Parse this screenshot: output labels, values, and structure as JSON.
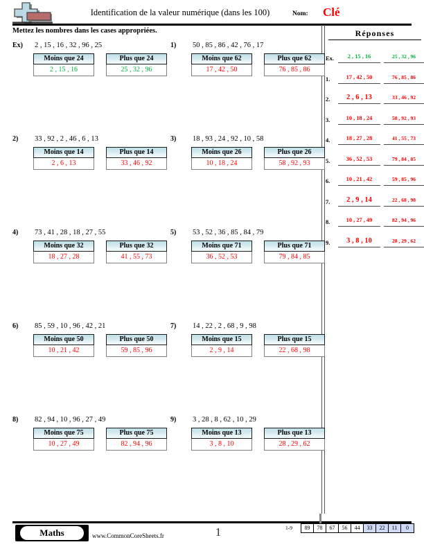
{
  "header": {
    "title": "Identification de la valeur numérique (dans les 100)",
    "name_label": "Nom:",
    "name_value": "Clé",
    "logo_icon": "plus-block-logo"
  },
  "instruction": "Mettez les nombres dans les cases appropriées.",
  "answers_panel": {
    "title": "Réponses",
    "rows": [
      {
        "num": "Ex.",
        "left": "2 , 15 , 16",
        "right": "25 , 32 , 96",
        "example": true,
        "left_size": "sz-md",
        "right_size": "sz-sm"
      },
      {
        "num": "1.",
        "left": "17 , 42 , 50",
        "right": "76 , 85 , 86",
        "example": false,
        "left_size": "sz-md",
        "right_size": "sz-sm"
      },
      {
        "num": "2.",
        "left": "2 , 6 , 13",
        "right": "33 , 46 , 92",
        "example": false,
        "left_size": "sz-lg",
        "right_size": "sz-sm"
      },
      {
        "num": "3.",
        "left": "10 , 18 , 24",
        "right": "58 , 92 , 93",
        "example": false,
        "left_size": "sz-md",
        "right_size": "sz-sm"
      },
      {
        "num": "4.",
        "left": "18 , 27 , 28",
        "right": "41 , 55 , 73",
        "example": false,
        "left_size": "sz-md",
        "right_size": "sz-sm"
      },
      {
        "num": "5.",
        "left": "36 , 52 , 53",
        "right": "79 , 84 , 85",
        "example": false,
        "left_size": "sz-md",
        "right_size": "sz-sm"
      },
      {
        "num": "6.",
        "left": "10 , 21 , 42",
        "right": "59 , 85 , 96",
        "example": false,
        "left_size": "sz-md",
        "right_size": "sz-sm"
      },
      {
        "num": "7.",
        "left": "2 , 9 , 14",
        "right": "22 , 68 , 98",
        "example": false,
        "left_size": "sz-lg",
        "right_size": "sz-sm"
      },
      {
        "num": "8.",
        "left": "10 , 27 , 49",
        "right": "82 , 94 , 96",
        "example": false,
        "left_size": "sz-md",
        "right_size": "sz-sm"
      },
      {
        "num": "9.",
        "left": "3 , 8 , 10",
        "right": "28 , 29 , 62",
        "example": false,
        "left_size": "sz-lg",
        "right_size": "sz-sm"
      }
    ]
  },
  "problems": [
    {
      "label": "Ex)",
      "numbers": "2 , 15 , 16 , 32 , 96 , 25",
      "less_header": "Moins que 24",
      "more_header": "Plus que 24",
      "less_answer": "2 , 15 , 16",
      "more_answer": "25 , 32 , 96",
      "example": true
    },
    {
      "label": "1)",
      "numbers": "50 , 85 , 86 , 42 , 76 , 17",
      "less_header": "Moins que 62",
      "more_header": "Plus que 62",
      "less_answer": "17 , 42 , 50",
      "more_answer": "76 , 85 , 86",
      "example": false
    },
    {
      "label": "2)",
      "numbers": "33 , 92 , 2 , 46 , 6 , 13",
      "less_header": "Moins que 14",
      "more_header": "Plus que 14",
      "less_answer": "2 , 6 , 13",
      "more_answer": "33 , 46 , 92",
      "example": false
    },
    {
      "label": "3)",
      "numbers": "18 , 93 , 24 , 92 , 10 , 58",
      "less_header": "Moins que 26",
      "more_header": "Plus que 26",
      "less_answer": "10 , 18 , 24",
      "more_answer": "58 , 92 , 93",
      "example": false
    },
    {
      "label": "4)",
      "numbers": "73 , 41 , 28 , 18 , 27 , 55",
      "less_header": "Moins que 32",
      "more_header": "Plus que 32",
      "less_answer": "18 , 27 , 28",
      "more_answer": "41 , 55 , 73",
      "example": false
    },
    {
      "label": "5)",
      "numbers": "53 , 52 , 36 , 85 , 84 , 79",
      "less_header": "Moins que 71",
      "more_header": "Plus que 71",
      "less_answer": "36 , 52 , 53",
      "more_answer": "79 , 84 , 85",
      "example": false
    },
    {
      "label": "6)",
      "numbers": "85 , 59 , 10 , 96 , 42 , 21",
      "less_header": "Moins que 50",
      "more_header": "Plus que 50",
      "less_answer": "10 , 21 , 42",
      "more_answer": "59 , 85 , 96",
      "example": false
    },
    {
      "label": "7)",
      "numbers": "14 , 22 , 2 , 68 , 9 , 98",
      "less_header": "Moins que 15",
      "more_header": "Plus que 15",
      "less_answer": "2 , 9 , 14",
      "more_answer": "22 , 68 , 98",
      "example": false
    },
    {
      "label": "8)",
      "numbers": "82 , 94 , 10 , 96 , 27 , 49",
      "less_header": "Moins que 75",
      "more_header": "Plus que 75",
      "less_answer": "10 , 27 , 49",
      "more_answer": "82 , 94 , 96",
      "example": false
    },
    {
      "label": "9)",
      "numbers": "3 , 28 , 8 , 62 , 10 , 29",
      "less_header": "Moins que 13",
      "more_header": "Plus que 13",
      "less_answer": "3 , 8 , 10",
      "more_answer": "28 , 29 , 62",
      "example": false
    }
  ],
  "footer": {
    "brand": "Maths",
    "url": "www.CommonCoreSheets.fr",
    "page_number": "1",
    "score_range": "1-9",
    "score_cells": [
      {
        "value": "89",
        "highlight": false
      },
      {
        "value": "78",
        "highlight": false
      },
      {
        "value": "67",
        "highlight": false
      },
      {
        "value": "56",
        "highlight": false
      },
      {
        "value": "44",
        "highlight": false
      },
      {
        "value": "33",
        "highlight": true
      },
      {
        "value": "22",
        "highlight": true
      },
      {
        "value": "11",
        "highlight": true
      },
      {
        "value": "0",
        "highlight": true
      }
    ]
  },
  "colors": {
    "answer_red": "#ff0000",
    "answer_green": "#00b33c",
    "box_header_blue": "#bfe0e8",
    "score_highlight": "#cdd9f5",
    "logo_blue": "#bcd9e6",
    "logo_red": "#b86b6b"
  }
}
